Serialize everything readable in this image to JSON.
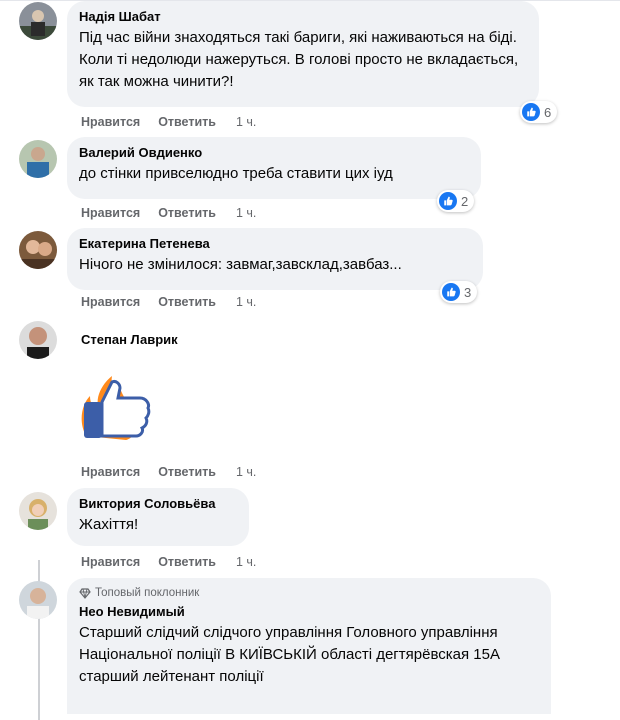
{
  "actions": {
    "like": "Нравится",
    "reply": "Ответить",
    "time": "1 ч."
  },
  "comments": [
    {
      "author": "Надія Шабат",
      "text": "Під час війни знаходяться такі бариги, які наживаються на біді. Коли ті недолюди нажеруться. В голові просто не вкладається, як так можна чинити?!",
      "likes": "6"
    },
    {
      "author": "Валерий Овдиенко",
      "text": "до стінки привселюдно треба ставити цих іуд",
      "likes": "2"
    },
    {
      "author": "Екатерина Петенева",
      "text": "Нічого не змінилося: завмаг,завсклад,завбаз...",
      "likes": "3"
    },
    {
      "author": "Степан Лаврик",
      "sticker": "thumbs-up-fire-sticker"
    },
    {
      "author": "Виктория Соловьёва",
      "text": "Жахіття!"
    },
    {
      "author": "Нео Невидимый",
      "badge": "Топовый поклонник",
      "text": "Старший слідчий слідчого управління Головного управління Національної поліції В КИЇВСЬКІЙ області дегтярёвская 15А старший лейтенант поліції"
    }
  ],
  "colors": {
    "like_blue": "#1877f2",
    "bubble_bg": "#f0f2f5",
    "meta_gray": "#65676b"
  }
}
